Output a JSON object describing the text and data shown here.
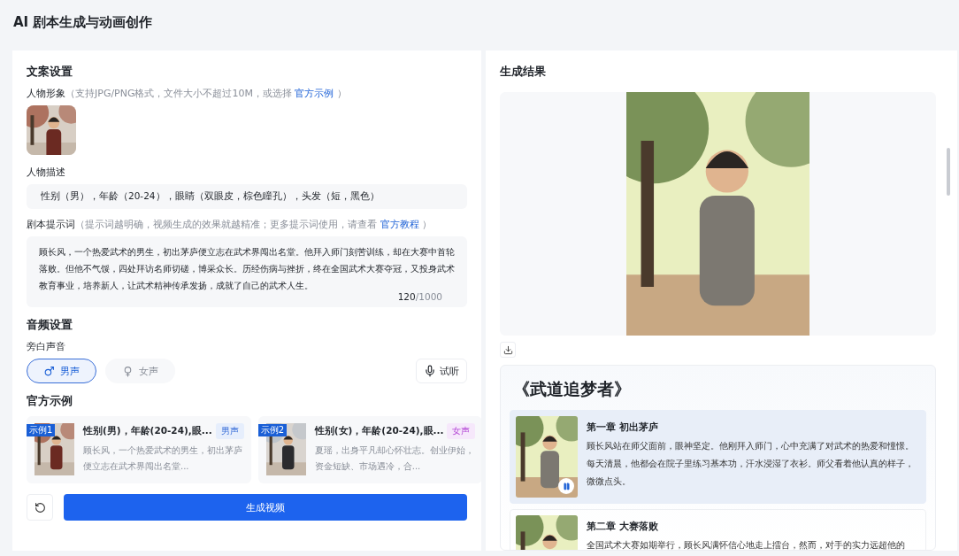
{
  "page": {
    "title": "AI 剧本生成与动画创作"
  },
  "copy_settings": {
    "heading": "文案设置",
    "avatar": {
      "label": "人物形象",
      "hint": "（支持JPG/PNG格式，文件大小不超过10M，或选择 ",
      "link": "官方示例",
      "hint_end": " ）"
    },
    "description": {
      "label": "人物描述",
      "value": "性别（男），年龄（20-24），眼睛（双眼皮，棕色瞳孔），头发（短，黑色）"
    },
    "prompt": {
      "label": "剧本提示词",
      "hint": "（提示词越明确，视频生成的效果就越精准；更多提示词使用，请查看 ",
      "link": "官方教程",
      "hint_end": " ）",
      "value": "顾长风，一个热爱武术的男生，初出茅庐便立志在武术界闯出名堂。他拜入师门刻苦训练，却在大赛中首轮落败。但他不气馁，四处拜访名师切磋，博采众长。历经伤病与挫折，终在全国武术大赛夺冠，又投身武术教育事业，培养新人，让武术精神传承发扬，成就了自己的武术人生。",
      "count": "120",
      "limit": "/1000"
    }
  },
  "audio_settings": {
    "heading": "音频设置",
    "label": "旁白声音",
    "voices": [
      {
        "label": "男声",
        "kind": "male",
        "selected": true
      },
      {
        "label": "女声",
        "kind": "female",
        "selected": false
      }
    ],
    "preview_button": "试听"
  },
  "examples": {
    "heading": "官方示例",
    "items": [
      {
        "badge": "示例1",
        "title": "性别(男)，年龄(20-24),眼...",
        "voice": "男声",
        "kind": "male",
        "text": "顾长风，一个热爱武术的男生，初出茅庐便立志在武术界闯出名堂..."
      },
      {
        "badge": "示例2",
        "title": "性别(女)，年龄(20-24),眼...",
        "voice": "女声",
        "kind": "female",
        "text": "夏瑶，出身平凡却心怀壮志。创业伊始，资金短缺、市场遇冷，合..."
      }
    ]
  },
  "generate_button": "生成视频",
  "result": {
    "heading": "生成结果",
    "story": {
      "title": "《武道追梦者》",
      "chapters": [
        {
          "title": "第一章 初出茅庐",
          "text": "顾长风站在师父面前，眼神坚定。他刚拜入师门，心中充满了对武术的热爱和憧憬。每天清晨，他都会在院子里练习基本功，汗水浸湿了衣衫。师父看着他认真的样子，微微点头。",
          "selected": true
        },
        {
          "title": "第二章 大赛落败",
          "text": "全国武术大赛如期举行，顾长风满怀信心地走上擂台，然而，对手的实力远超他的",
          "selected": false
        }
      ]
    }
  }
}
